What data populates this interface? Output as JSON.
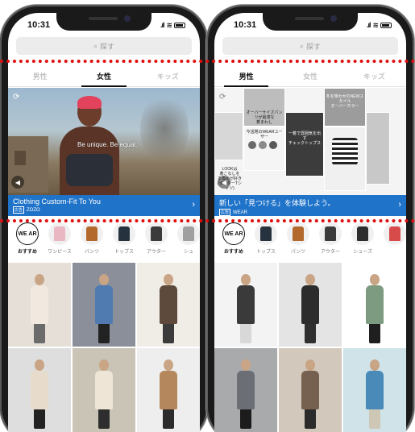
{
  "annotation_lines": {
    "color": "#e00d0d"
  },
  "left": {
    "status": {
      "time": "10:31",
      "signal": ".ıl",
      "wifi": "≋"
    },
    "search": {
      "placeholder": "探す"
    },
    "tabs": [
      "男性",
      "女性",
      "キッズ"
    ],
    "active_tab": 1,
    "banner": {
      "tagline": "Be unique. Be equal.",
      "ad_title": "Clothing Custom-Fit To You",
      "ad_badge": "広告",
      "ad_brand": "ZOZO"
    },
    "categories": [
      {
        "label": "おすすめ",
        "logo": "WE AR",
        "color": ""
      },
      {
        "label": "ワンピース",
        "color": "#e8b7c1"
      },
      {
        "label": "パンツ",
        "color": "#b3692c"
      },
      {
        "label": "トップス",
        "color": "#27323f"
      },
      {
        "label": "アウター",
        "color": "#3b3b3b"
      },
      {
        "label": "シュ",
        "color": "#a0a0a0"
      }
    ],
    "grid": [
      {
        "bg": "#e6dfd8",
        "top": "#f1e8e0",
        "bottom": "#6b6b6b"
      },
      {
        "bg": "#8a8f99",
        "top": "#4f7bb0",
        "bottom": "#222222"
      },
      {
        "bg": "#f0ece6",
        "top": "#5e4a3c",
        "bottom": "#3b3b3b"
      },
      {
        "bg": "#dedede",
        "top": "#e7dccc",
        "bottom": "#222222"
      },
      {
        "bg": "#c9c4b5",
        "top": "#efe5d6",
        "bottom": "#2e2e2e"
      },
      {
        "bg": "#eeeeee",
        "top": "#b4885c",
        "bottom": "#2b2b2b"
      }
    ]
  },
  "right": {
    "status": {
      "time": "10:31",
      "signal": ".ıl",
      "wifi": "≋"
    },
    "search": {
      "placeholder": "探す"
    },
    "tabs": [
      "男性",
      "女性",
      "キッズ"
    ],
    "active_tab": 0,
    "banner": {
      "ad_title": "新しい「見つける」を体験しよう。",
      "ad_badge": "広告",
      "ad_brand": "WEAR",
      "collage": [
        {
          "text": "オーバーサイズパンツが最適な\n着まわし"
        },
        {
          "text": "冬を味わせのNEWスタイル\nオーバーカラー"
        },
        {
          "text": "今話題のWEARユーザー"
        },
        {
          "text": "一着で雰囲気を出す\nチェックトップス"
        },
        {
          "text": "LOOKは\n着こなしを\nするのが好き\n(ボーダーTシャツ)"
        }
      ]
    },
    "categories": [
      {
        "label": "おすすめ",
        "logo": "WE AR",
        "color": ""
      },
      {
        "label": "トップス",
        "color": "#27323f"
      },
      {
        "label": "パンツ",
        "color": "#b3692c"
      },
      {
        "label": "アウター",
        "color": "#3b3b3b"
      },
      {
        "label": "シューズ",
        "color": "#2d2d2d"
      },
      {
        "label": "",
        "color": "#d84b4b"
      }
    ],
    "grid": [
      {
        "bg": "#f3f3f3",
        "top": "#3a3a3a",
        "bottom": "#d8d8d8"
      },
      {
        "bg": "#e4e4e4",
        "top": "#2c2c2c",
        "bottom": "#2f2f2f"
      },
      {
        "bg": "#ffffff",
        "top": "#7d9b80",
        "bottom": "#1f1f1f"
      },
      {
        "bg": "#a8aaac",
        "top": "#6b6f75",
        "bottom": "#1c1c1c"
      },
      {
        "bg": "#d2c8bb",
        "top": "#766150",
        "bottom": "#2b2b2b"
      },
      {
        "bg": "#cfe3e9",
        "top": "#4a8ab8",
        "bottom": "#cfc7b6"
      }
    ]
  }
}
